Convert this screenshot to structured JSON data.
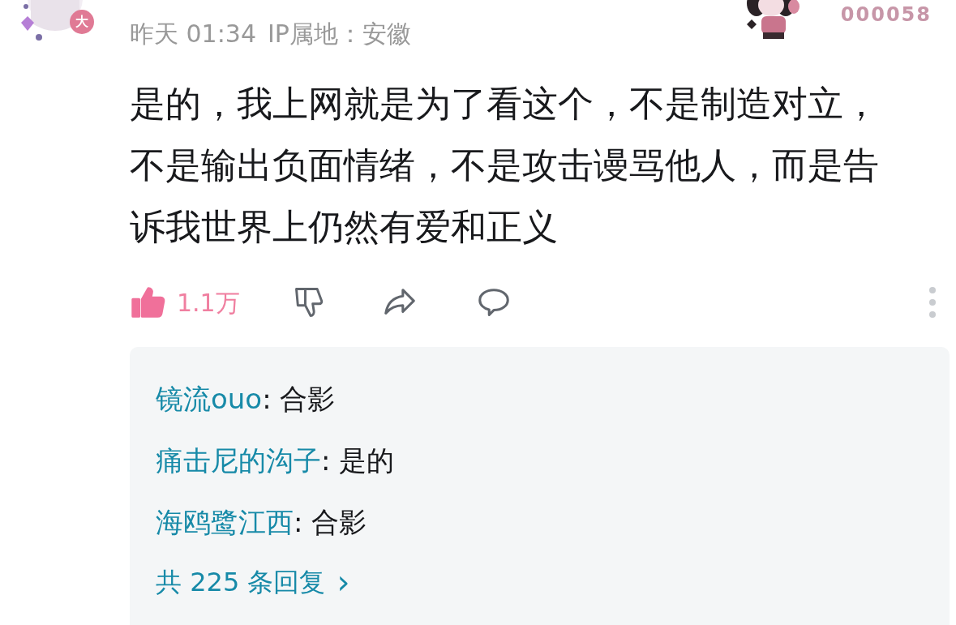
{
  "comment": {
    "avatar_badge": "大",
    "time": "昨天 01:34",
    "ip_location": "IP属地：安徽",
    "fan_number": "000058",
    "text": "是的，我上网就是为了看这个，不是制造对立，不是输出负面情绪，不是攻击谩骂他人，而是告诉我世界上仍然有爱和正义",
    "like": {
      "liked": true,
      "count": "1.1万"
    }
  },
  "replies": [
    {
      "user": "镜流ouo",
      "text": ": 合影"
    },
    {
      "user": "痛击尼的沟子",
      "text": ": 是的"
    },
    {
      "user": "海鸥鹭江西",
      "text": ": 合影"
    }
  ],
  "more_replies": {
    "label": "共 225 条回复",
    "arrow": "›"
  }
}
